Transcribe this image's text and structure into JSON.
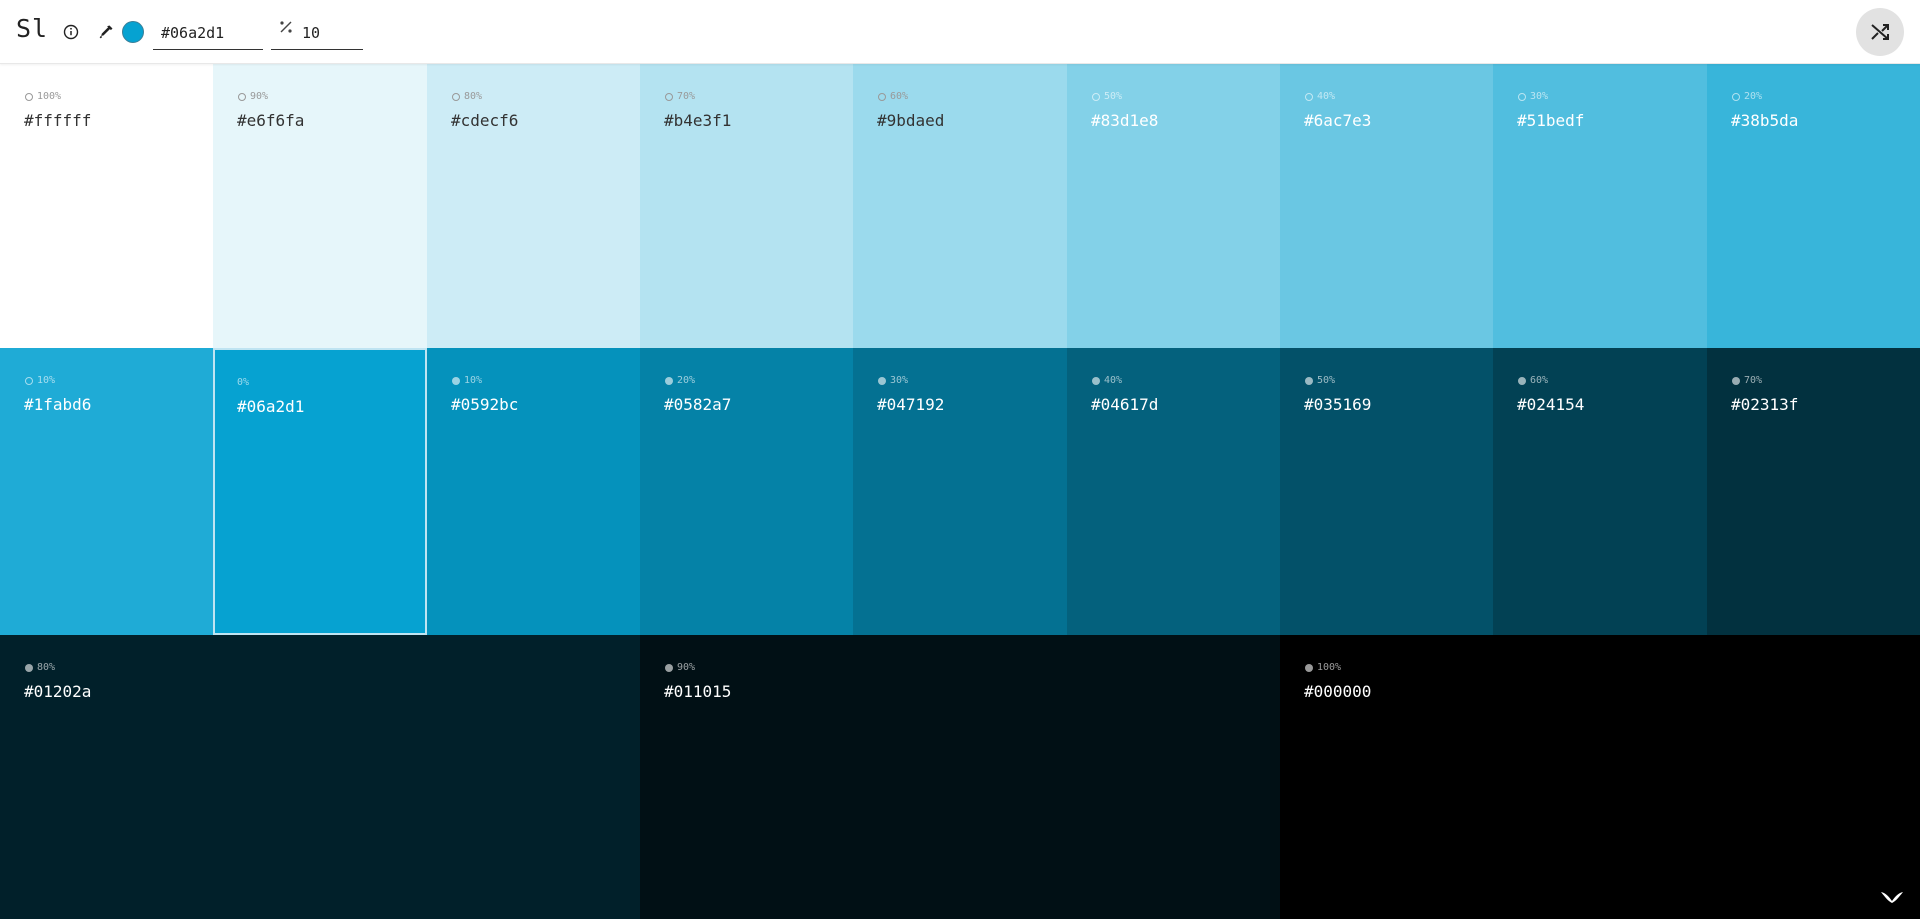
{
  "app": {
    "logo": "Sl"
  },
  "toolbar": {
    "info_icon": "info-icon",
    "picker_icon": "eyedropper-icon",
    "current_color": "#06a2d1",
    "hex_value": "#06a2d1",
    "step_icon": "percent-icon",
    "step_value": "10",
    "shuffle_icon": "shuffle-icon"
  },
  "tints": [
    {
      "pct": "100%",
      "hex": "#ffffff"
    },
    {
      "pct": "90%",
      "hex": "#e6f6fa"
    },
    {
      "pct": "80%",
      "hex": "#cdecf6"
    },
    {
      "pct": "70%",
      "hex": "#b4e3f1"
    },
    {
      "pct": "60%",
      "hex": "#9bdaed"
    },
    {
      "pct": "50%",
      "hex": "#83d1e8"
    },
    {
      "pct": "40%",
      "hex": "#6ac7e3"
    },
    {
      "pct": "30%",
      "hex": "#51bedf"
    },
    {
      "pct": "20%",
      "hex": "#38b5da"
    }
  ],
  "middle": [
    {
      "pct": "10%",
      "hex": "#1fabd6"
    },
    {
      "pct": "0%",
      "hex": "#06a2d1"
    },
    {
      "pct": "10%",
      "hex": "#0592bc"
    },
    {
      "pct": "20%",
      "hex": "#0582a7"
    },
    {
      "pct": "30%",
      "hex": "#047192"
    },
    {
      "pct": "40%",
      "hex": "#04617d"
    },
    {
      "pct": "50%",
      "hex": "#035169"
    },
    {
      "pct": "60%",
      "hex": "#024154"
    },
    {
      "pct": "70%",
      "hex": "#02313f"
    }
  ],
  "shades": [
    {
      "pct": "80%",
      "hex": "#01202a"
    },
    {
      "pct": "90%",
      "hex": "#011015"
    },
    {
      "pct": "100%",
      "hex": "#000000"
    }
  ],
  "footer": {
    "logo_icon": "bird-logo-icon"
  }
}
